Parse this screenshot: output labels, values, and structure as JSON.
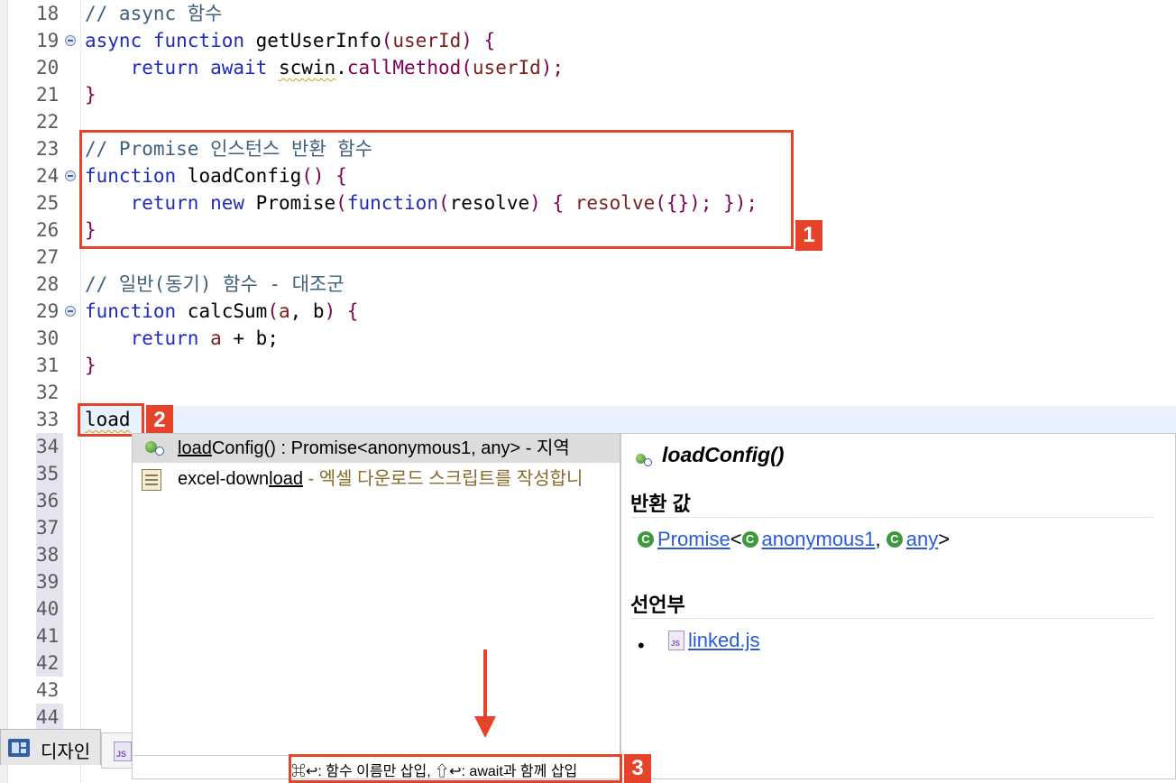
{
  "editor": {
    "line_numbers": [
      "18",
      "19",
      "20",
      "21",
      "22",
      "23",
      "24",
      "25",
      "26",
      "27",
      "28",
      "29",
      "30",
      "31",
      "32",
      "33",
      "34",
      "35",
      "36",
      "37",
      "38",
      "39",
      "40",
      "41",
      "42",
      "43",
      "44"
    ],
    "lines": {
      "l18": "// async 함수",
      "l19_kw": "async function ",
      "l19_name": "getUserInfo",
      "l19_rest_a": "(",
      "l19_param": "userId",
      "l19_rest_b": ") {",
      "l20_kw": "    return await ",
      "l20_obj": "scwin",
      "l20_dot": ".",
      "l20_method": "callMethod",
      "l20_open": "(",
      "l20_arg": "userId",
      "l20_close": ");",
      "l21": "}",
      "l23": "// Promise 인스턴스 반환 함수",
      "l24_kw": "function ",
      "l24_name": "loadConfig",
      "l24_rest": "() {",
      "l25_kw": "    return new ",
      "l25_promise": "Promise",
      "l25_open": "(",
      "l25_fn": "function",
      "l25_p1": "(",
      "l25_param": "resolve",
      "l25_p2": ") { ",
      "l25_call": "resolve",
      "l25_end": "({}); });",
      "l26": "}",
      "l28": "// 일반(동기) 함수 - 대조군",
      "l29_kw": "function ",
      "l29_name": "calcSum",
      "l29_p1": "(",
      "l29_a": "a",
      "l29_comma": ", ",
      "l29_b": "b",
      "l29_rest": ") {",
      "l30_kw": "    return ",
      "l30_a": "a",
      "l30_plus": " + ",
      "l30_b": "b",
      "l30_semi": ";",
      "l31": "}",
      "l33": "load"
    }
  },
  "annotations": {
    "n1": "1",
    "n2": "2",
    "n3": "3"
  },
  "bottom_tabs": {
    "design_label": "디자인",
    "js_label": "JS"
  },
  "content_assist": {
    "items": [
      {
        "match": "load",
        "rest": "Config() : Promise<anonymous1, any> - 지역",
        "icon": "public-method-icon"
      },
      {
        "prefix": "excel-down",
        "match": "load",
        "desc": " - 엑셀 다운로드 스크립트를 작성합니",
        "icon": "template-icon"
      }
    ],
    "footer": "⌘↩: 함수 이름만 삽입, ⇧↩: await과 함께 삽입"
  },
  "doc_popup": {
    "title": "loadConfig()",
    "return_heading": "반환 값",
    "return_types": {
      "type": "Promise",
      "lt": "<",
      "arg1": "anonymous1",
      "comma": ", ",
      "arg2": "any",
      "gt": ">",
      "class_letter": "C"
    },
    "decl_heading": "선언부",
    "decl_bullet": "•",
    "decl_file": "linked.js",
    "file_icon_label": "JS"
  },
  "colors": {
    "keyword": "#1f2bbd",
    "comment": "#3f5f7f",
    "function": "#7f0055",
    "annotation": "#e5432a",
    "link": "#2a5bd7"
  }
}
